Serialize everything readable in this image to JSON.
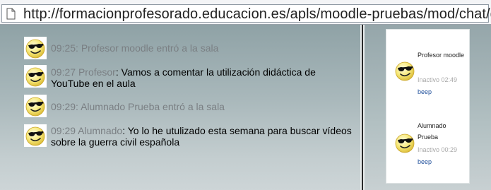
{
  "browser": {
    "url": "http://formacionprofesorado.educacion.es/apls/moodle-pruebas/mod/chat/gui"
  },
  "messages": [
    {
      "time": "09:25:",
      "text": "Profesor moodle entró a la sala",
      "type": "system"
    },
    {
      "time": "09:27",
      "author": "Profesor",
      "text": "Vamos a comentar la utilización didáctica de YouTube en el aula",
      "type": "user"
    },
    {
      "time": "09:29:",
      "text": "Alumnado Prueba entró a la sala",
      "type": "system"
    },
    {
      "time": "09:29",
      "author": "Alumnado",
      "text": "Yo lo he utulizado esta semana para buscar vídeos sobre la guerra civil española",
      "type": "user"
    }
  ],
  "users": [
    {
      "name": "Profesor moodle",
      "idle": "Inactivo 02:49",
      "beep": "beep"
    },
    {
      "name": "Alumnado Prueba",
      "idle": "Inactivo 00:29",
      "beep": "beep"
    }
  ],
  "icons": {
    "page": "page-icon",
    "avatar": "smiley-sunglasses-icon"
  },
  "colors": {
    "system_text": "#7a7f83",
    "message_text": "#000000",
    "link": "#1c4d9a"
  }
}
